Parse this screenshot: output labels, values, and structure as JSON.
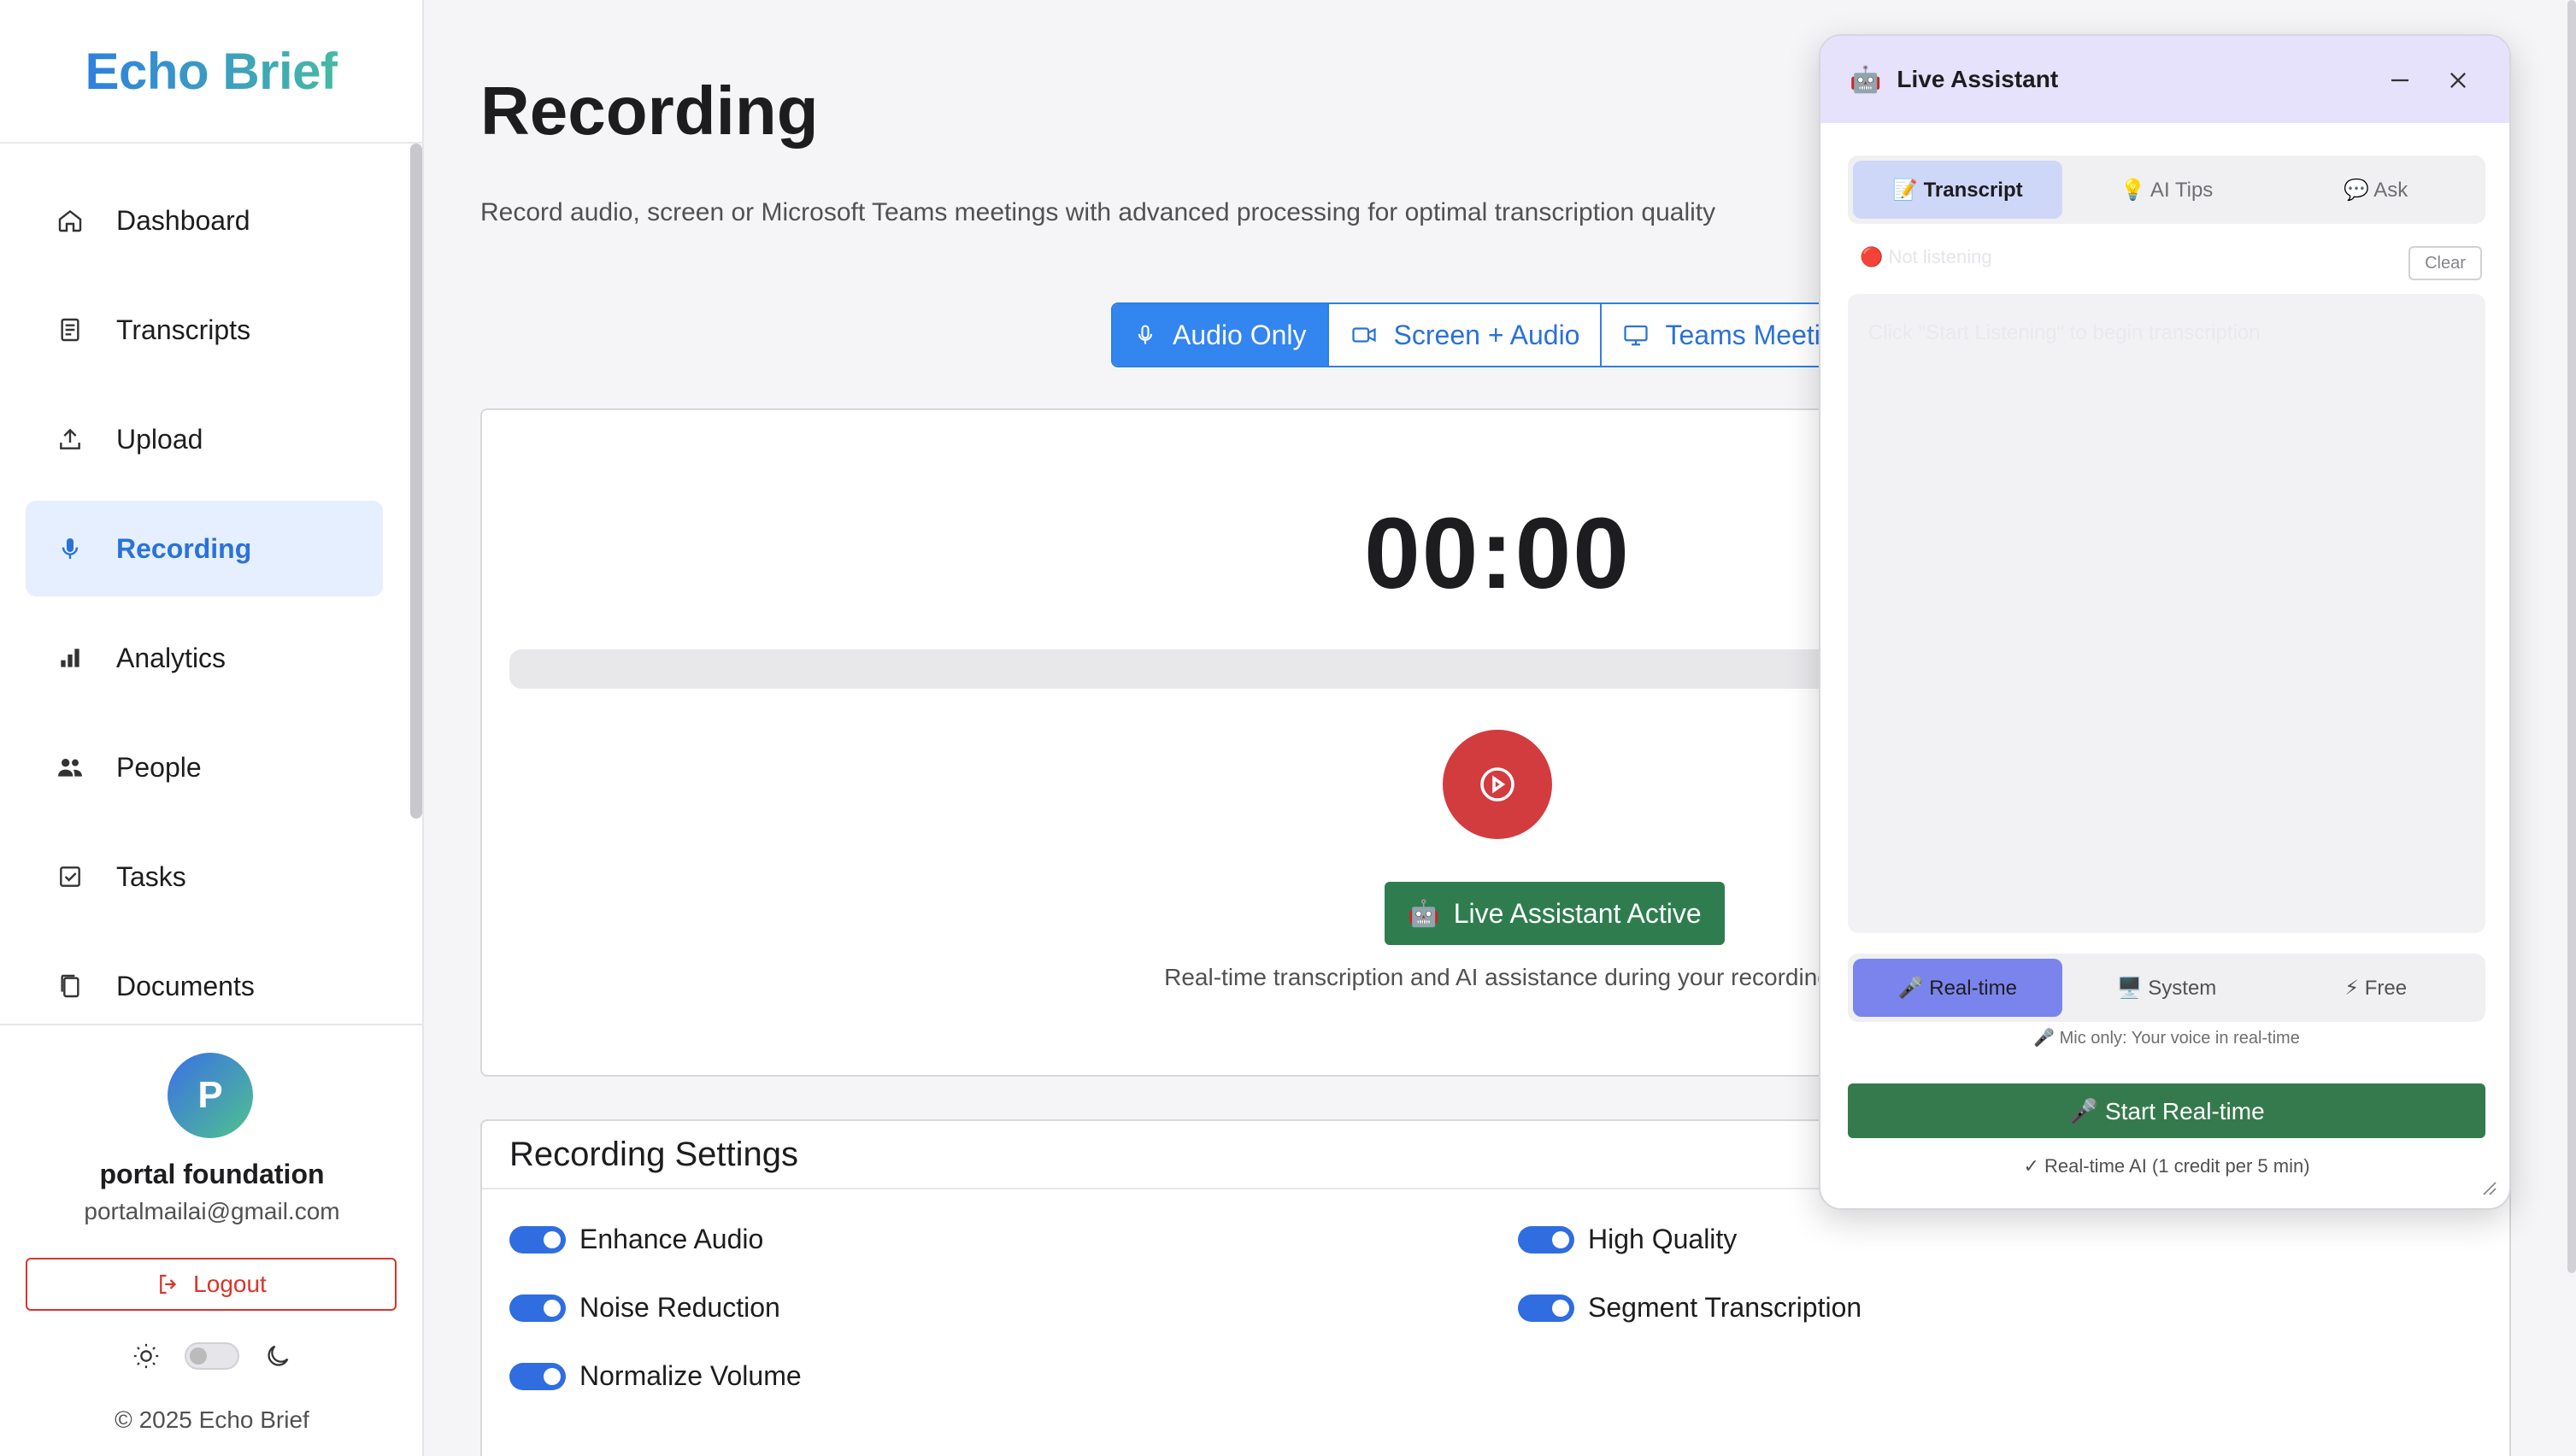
{
  "app": {
    "name": "Echo Brief"
  },
  "sidebar": {
    "items": [
      {
        "label": "Dashboard",
        "icon": "home-icon"
      },
      {
        "label": "Transcripts",
        "icon": "document-icon"
      },
      {
        "label": "Upload",
        "icon": "upload-icon"
      },
      {
        "label": "Recording",
        "icon": "microphone-icon",
        "active": true
      },
      {
        "label": "Analytics",
        "icon": "bar-chart-icon"
      },
      {
        "label": "People",
        "icon": "people-icon"
      },
      {
        "label": "Tasks",
        "icon": "checkbox-icon"
      },
      {
        "label": "Documents",
        "icon": "copy-icon"
      }
    ]
  },
  "profile": {
    "initial": "P",
    "name": "portal foundation",
    "email": "portalmailai@gmail.com",
    "logout_label": "Logout",
    "copyright": "© 2025 Echo Brief"
  },
  "page": {
    "title": "Recording",
    "subtitle": "Record audio, screen or Microsoft Teams meetings with advanced processing for optimal transcription quality"
  },
  "modes": [
    {
      "label": "Audio Only",
      "icon": "microphone-icon",
      "active": true
    },
    {
      "label": "Screen + Audio",
      "icon": "video-camera-icon"
    },
    {
      "label": "Teams Meeting",
      "icon": "monitor-icon"
    }
  ],
  "recorder": {
    "timer": "00:00",
    "progress": 0,
    "live_button": "Live Assistant Active",
    "live_emoji": "🤖",
    "live_desc": "Real-time transcription and AI assistance during your recording"
  },
  "settings": {
    "title": "Recording Settings",
    "options": [
      {
        "label": "Enhance Audio",
        "on": true
      },
      {
        "label": "Noise Reduction",
        "on": true
      },
      {
        "label": "Normalize Volume",
        "on": true
      },
      {
        "label": "High Quality",
        "on": true
      },
      {
        "label": "Segment Transcription",
        "on": true
      }
    ]
  },
  "assistant": {
    "emoji": "🤖",
    "title": "Live Assistant",
    "tabs": [
      {
        "label": "📝 Transcript",
        "active": true
      },
      {
        "label": "💡 AI Tips"
      },
      {
        "label": "💬 Ask"
      }
    ],
    "status": "🔴 Not listening",
    "clear_label": "Clear",
    "hint": "Click \"Start Listening\" to begin transcription",
    "modes": [
      {
        "label": "🎤 Real-time",
        "active": true
      },
      {
        "label": "🖥️ System"
      },
      {
        "label": "⚡ Free"
      }
    ],
    "mic_note": "🎤 Mic only: Your voice in real-time",
    "start_label": "🎤 Start Real-time",
    "credit_note": "✓ Real-time AI (1 credit per 5 min)"
  },
  "colors": {
    "accent": "#2f7fe0",
    "record": "#d23c3f",
    "success": "#2f7d4f",
    "assistant_header": "#e6e2fb"
  }
}
